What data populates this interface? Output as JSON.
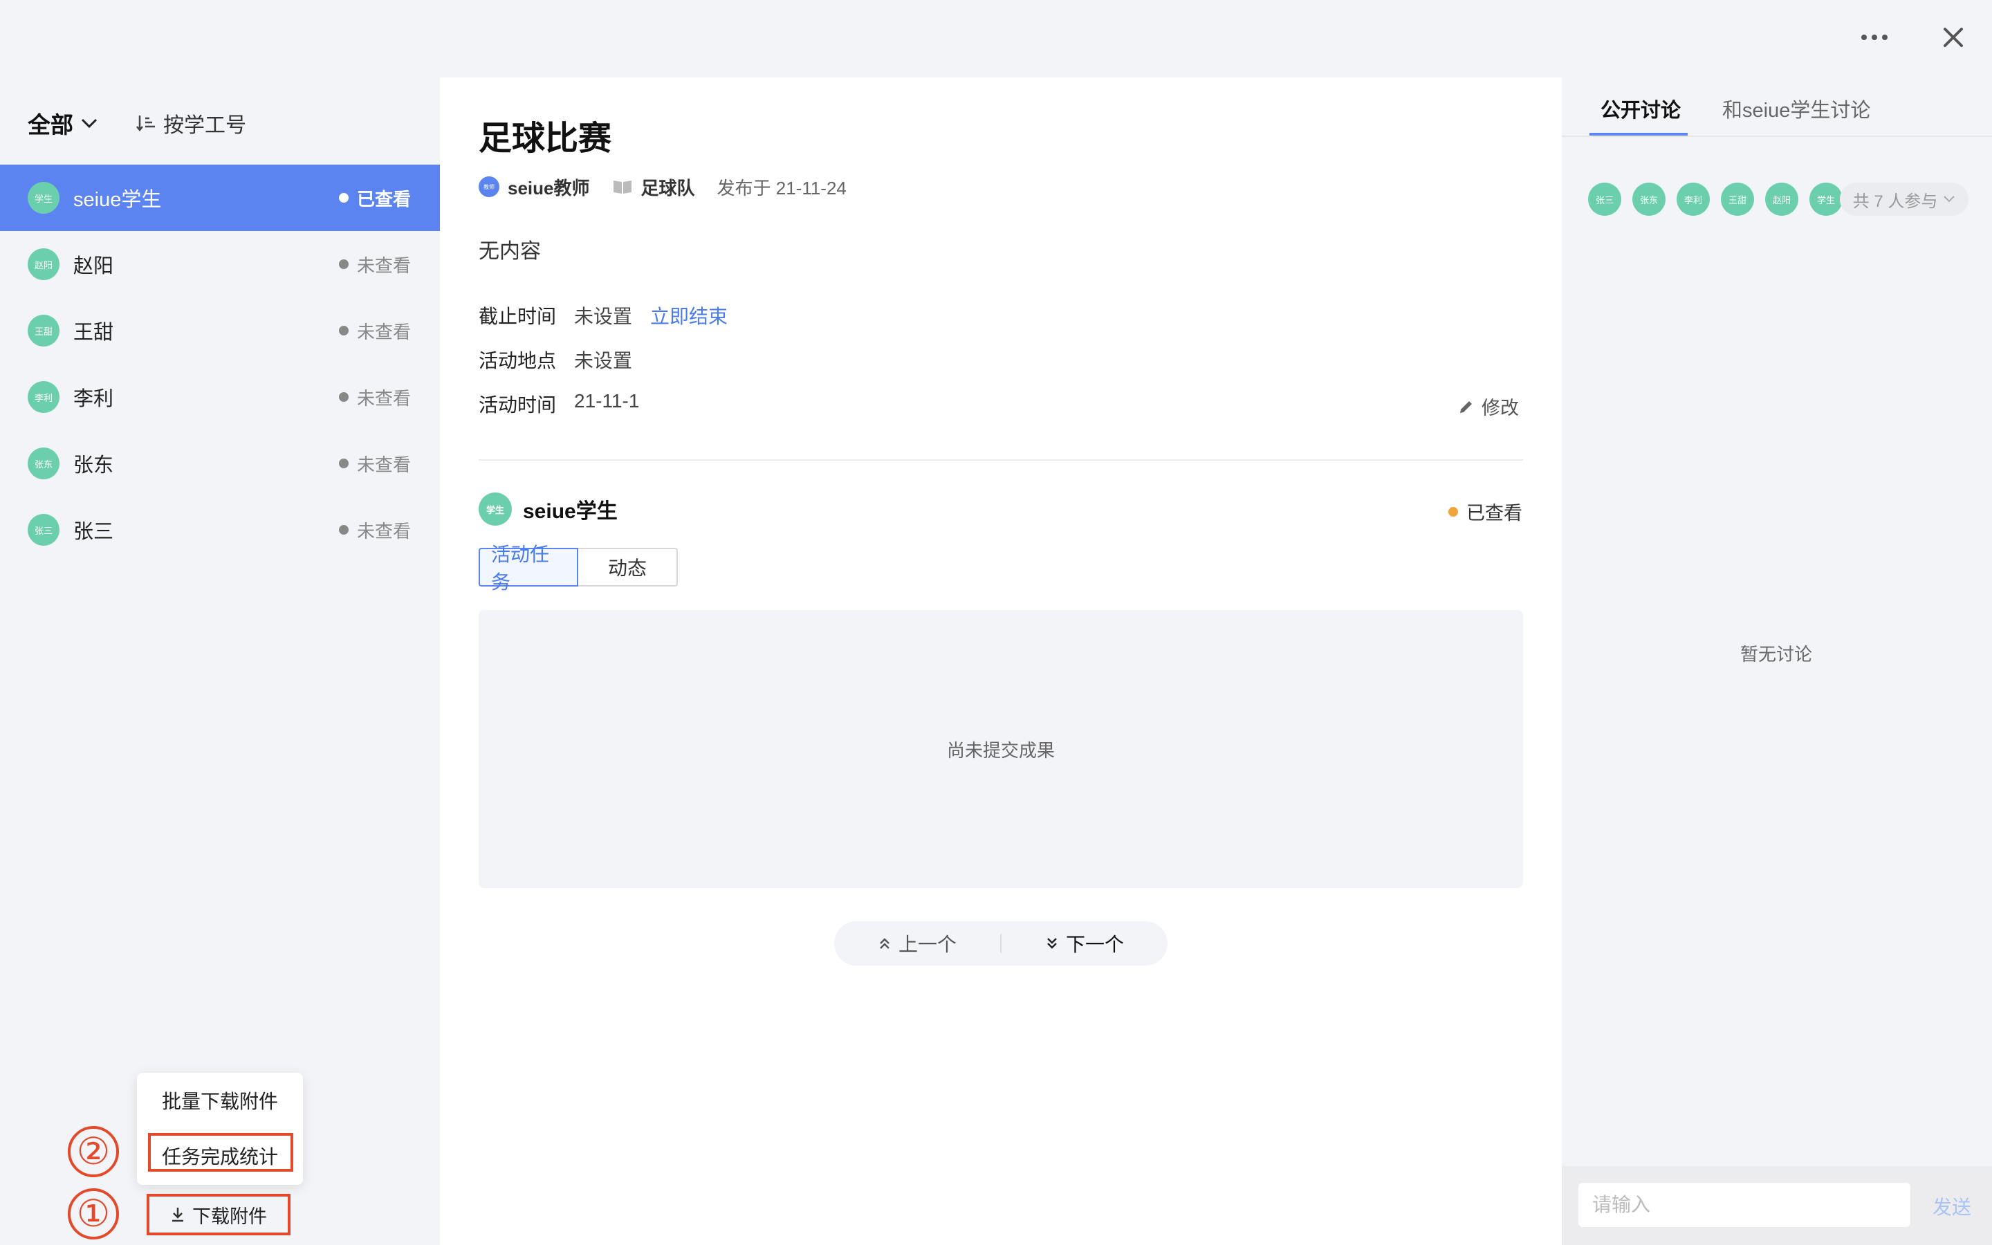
{
  "header": {
    "more_icon": "more-horizontal-icon",
    "close_icon": "close-icon"
  },
  "filter": {
    "all_label": "全部",
    "sort_label": "按学工号"
  },
  "students": [
    {
      "avatar": "学生",
      "name": "seiue学生",
      "status": "已查看",
      "active": true
    },
    {
      "avatar": "赵阳",
      "name": "赵阳",
      "status": "未查看"
    },
    {
      "avatar": "王甜",
      "name": "王甜",
      "status": "未查看"
    },
    {
      "avatar": "李利",
      "name": "李利",
      "status": "未查看"
    },
    {
      "avatar": "张东",
      "name": "张东",
      "status": "未查看"
    },
    {
      "avatar": "张三",
      "name": "张三",
      "status": "未查看"
    }
  ],
  "popup": {
    "batch_download": "批量下载附件",
    "task_stats": "任务完成统计",
    "download": "下载附件"
  },
  "annotations": {
    "one": "①",
    "two": "②"
  },
  "task": {
    "title": "足球比赛",
    "teacher_avatar": "教师",
    "teacher": "seiue教师",
    "group": "足球队",
    "published": "发布于 21-11-24",
    "content": "无内容",
    "deadline_label": "截止时间",
    "deadline_value": "未设置",
    "end_now": "立即结束",
    "location_label": "活动地点",
    "location_value": "未设置",
    "time_label": "活动时间",
    "time_value": "21-11-1",
    "edit": "修改"
  },
  "student_detail": {
    "avatar": "学生",
    "name": "seiue学生",
    "status": "已查看",
    "status_color": "#f0a43a",
    "tabs": [
      "活动任务",
      "动态"
    ],
    "empty": "尚未提交成果",
    "prev": "上一个",
    "next": "下一个"
  },
  "discussion": {
    "tabs": [
      "公开讨论",
      "和seiue学生讨论"
    ],
    "participants": [
      "张三",
      "张东",
      "李利",
      "王甜",
      "赵阳",
      "学生"
    ],
    "count_label": "共 7 人参与",
    "empty": "暂无讨论",
    "input_placeholder": "请输入",
    "send": "发送"
  },
  "colors": {
    "accent": "#5b84f1",
    "avatar": "#6bcfae",
    "annotation_red": "#e24a2b"
  }
}
